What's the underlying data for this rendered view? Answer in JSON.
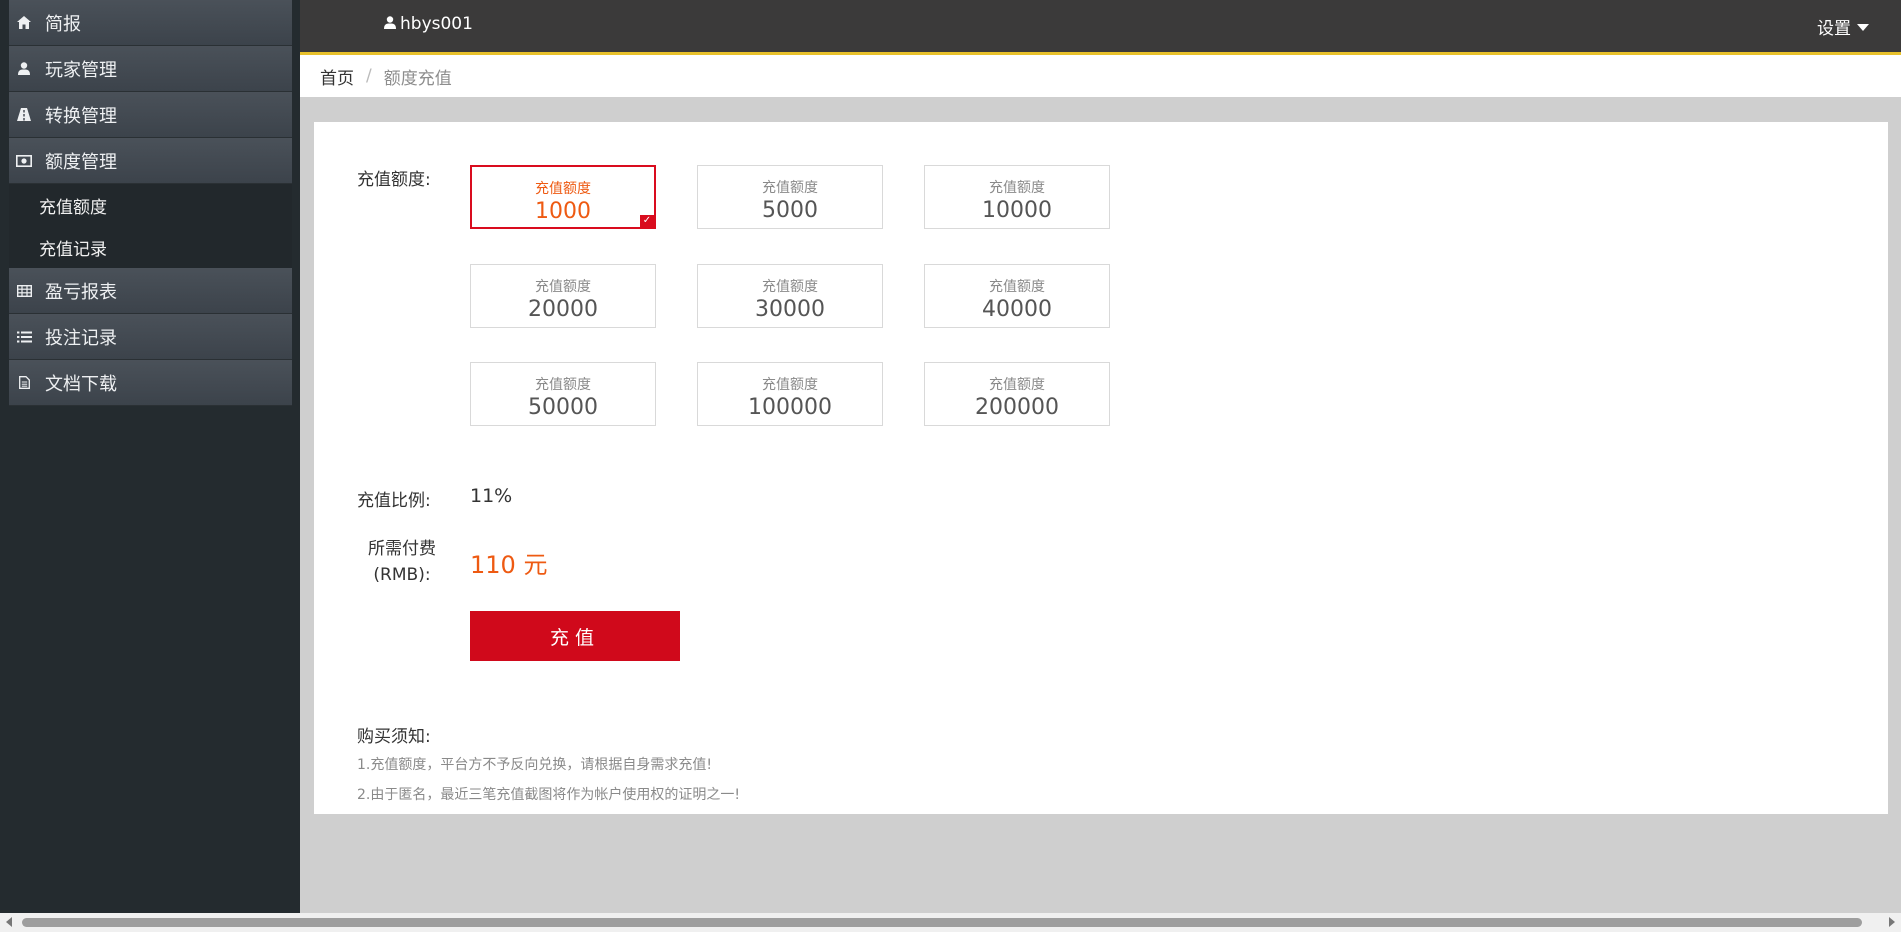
{
  "header": {
    "username": "hbys001",
    "settings_label": "设置"
  },
  "sidebar": {
    "items": [
      {
        "label": "简报",
        "icon": "home-icon"
      },
      {
        "label": "玩家管理",
        "icon": "user-icon"
      },
      {
        "label": "转换管理",
        "icon": "road-icon"
      },
      {
        "label": "额度管理",
        "icon": "money-icon"
      },
      {
        "label": "充值额度",
        "sub": true
      },
      {
        "label": "充值记录",
        "sub": true
      },
      {
        "label": "盈亏报表",
        "icon": "table-icon"
      },
      {
        "label": "投注记录",
        "icon": "list-icon"
      },
      {
        "label": "文档下载",
        "icon": "file-icon"
      }
    ]
  },
  "breadcrumb": {
    "home": "首页",
    "separator": "/",
    "current": "额度充值"
  },
  "form": {
    "amount_label": "充值额度:",
    "tile_caption": "充值额度",
    "amounts": [
      "1000",
      "5000",
      "10000",
      "20000",
      "30000",
      "40000",
      "50000",
      "100000",
      "200000"
    ],
    "selected_index": 0,
    "ratio_label": "充值比例:",
    "ratio_value": "11%",
    "fee_label_line1": "所需付费",
    "fee_label_line2": "(RMB):",
    "fee_value": "110 元",
    "submit_label": "充值"
  },
  "notice": {
    "title": "购买须知:",
    "items": [
      "1.充值额度，平台方不予反向兑换，请根据自身需求充值!",
      "2.由于匿名，最近三笔充值截图将作为帐户使用权的证明之一!"
    ]
  },
  "colors": {
    "accent_red": "#d0091b",
    "accent_orange": "#ee5a12",
    "topbar_border": "#e8c12b"
  }
}
